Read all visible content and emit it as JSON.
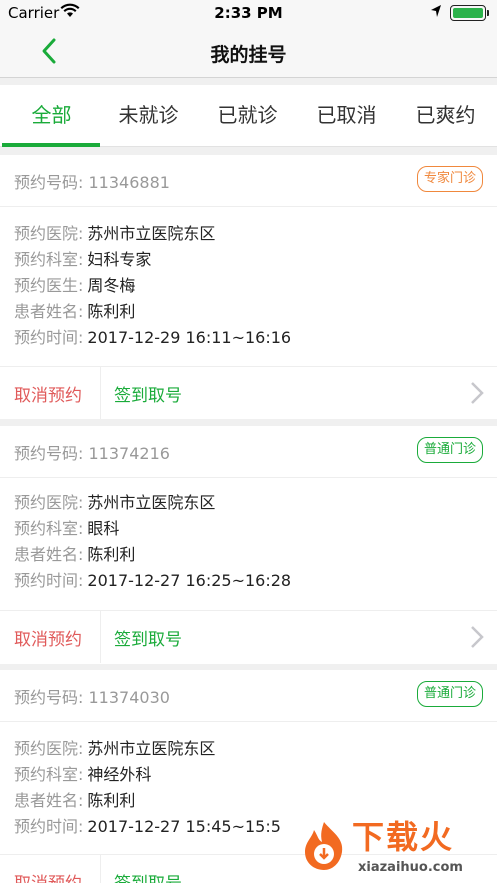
{
  "statusbar": {
    "carrier": "Carrier",
    "time": "2:33 PM"
  },
  "nav": {
    "title": "我的挂号"
  },
  "tabs": [
    {
      "label": "全部"
    },
    {
      "label": "未就诊"
    },
    {
      "label": "已就诊"
    },
    {
      "label": "已取消"
    },
    {
      "label": "已爽约"
    }
  ],
  "active_tab": "全部",
  "cards": [
    {
      "number_label": "预约号码:",
      "number": "11346881",
      "badge": "专家门诊",
      "rows": [
        {
          "k": "预约医院:",
          "v": "苏州市立医院东区"
        },
        {
          "k": "预约科室:",
          "v": "妇科专家"
        },
        {
          "k": "预约医生:",
          "v": "周冬梅"
        },
        {
          "k": "患者姓名:",
          "v": "陈利利"
        },
        {
          "k": "预约时间:",
          "v": "2017-12-29 16:11~16:16"
        }
      ],
      "cancel": "取消预约",
      "checkin": "签到取号"
    },
    {
      "number_label": "预约号码:",
      "number": "11374216",
      "badge": "普通门诊",
      "rows": [
        {
          "k": "预约医院:",
          "v": "苏州市立医院东区"
        },
        {
          "k": "预约科室:",
          "v": "眼科"
        },
        {
          "k": "患者姓名:",
          "v": "陈利利"
        },
        {
          "k": "预约时间:",
          "v": "2017-12-27 16:25~16:28"
        }
      ],
      "cancel": "取消预约",
      "checkin": "签到取号"
    },
    {
      "number_label": "预约号码:",
      "number": "11374030",
      "badge": "普通门诊",
      "rows": [
        {
          "k": "预约医院:",
          "v": "苏州市立医院东区"
        },
        {
          "k": "预约科室:",
          "v": "神经外科"
        },
        {
          "k": "患者姓名:",
          "v": "陈利利"
        },
        {
          "k": "预约时间:",
          "v": "2017-12-27 15:45~15:5"
        }
      ],
      "cancel": "取消预约",
      "checkin": "签到取号"
    }
  ],
  "watermark": {
    "title": "下载火",
    "url": "xiazaihuo.com"
  },
  "colors": {
    "accent": "#1aab3a",
    "cancel": "#e05a5a",
    "expert_badge": "#f0883d"
  }
}
